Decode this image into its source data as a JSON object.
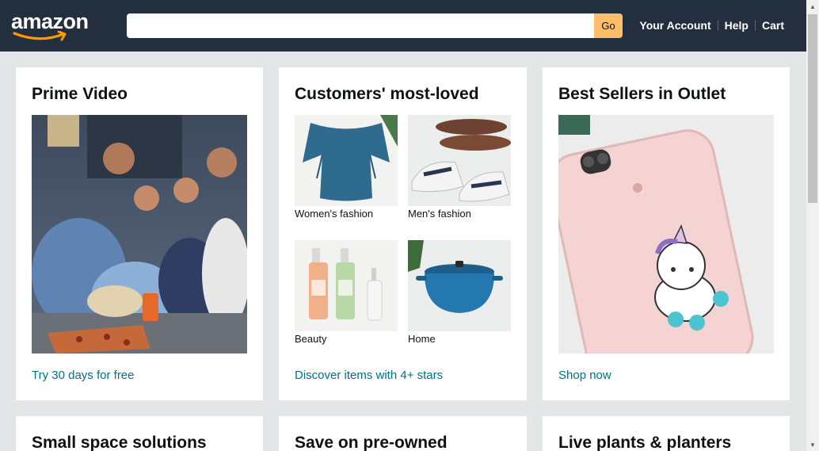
{
  "header": {
    "logo_text": "amazon",
    "search": {
      "value": "",
      "placeholder": ""
    },
    "search_button": "Go",
    "nav": {
      "account": "Your Account",
      "help": "Help",
      "cart": "Cart"
    }
  },
  "cards": {
    "prime": {
      "title": "Prime Video",
      "link": "Try 30 days for free"
    },
    "loved": {
      "title": "Customers' most-loved",
      "link": "Discover items with 4+ stars",
      "items": [
        {
          "label": "Women's fashion"
        },
        {
          "label": "Men's fashion"
        },
        {
          "label": "Beauty"
        },
        {
          "label": "Home"
        }
      ]
    },
    "outlet": {
      "title": "Best Sellers in Outlet",
      "link": "Shop now"
    },
    "small_space": {
      "title": "Small space solutions"
    },
    "preowned": {
      "title": "Save on pre-owned"
    },
    "plants": {
      "title": "Live plants & planters"
    }
  },
  "colors": {
    "header_bg": "#232f3e",
    "page_bg": "#e3e6e6",
    "link": "#007185",
    "go_button": "#febd69",
    "logo_smile": "#ff9900"
  }
}
